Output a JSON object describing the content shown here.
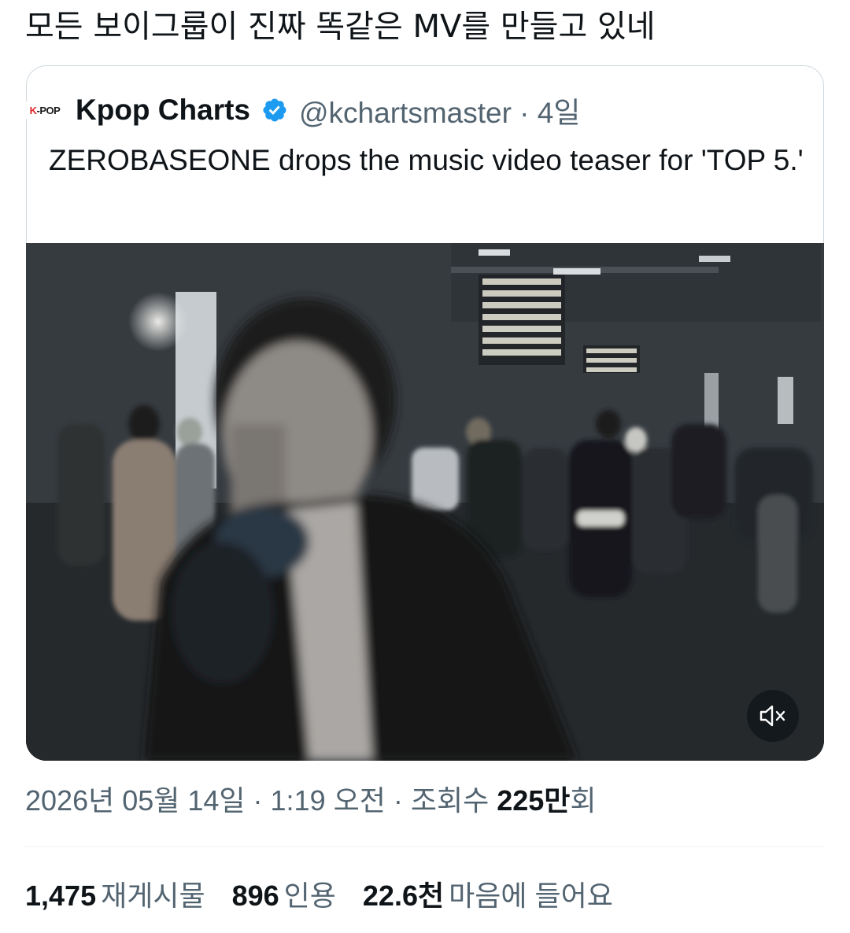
{
  "tweet": {
    "text": "모든 보이그룹이 진짜 똑같은 MV를 만들고 있네"
  },
  "quote": {
    "avatar_text_k": "K",
    "avatar_text_rest": "-POP",
    "display_name": "Kpop Charts",
    "verified_icon": "verified-badge-icon",
    "handle_time": "@kchartsmaster · 4일",
    "text": "ZEROBASEONE drops the music video teaser for 'TOP 5.'",
    "media": {
      "type": "video",
      "mute_icon": "speaker-muted-icon"
    }
  },
  "meta": {
    "date_time": "2026년 05월 14일 · 1:19 오전 · 조회수 ",
    "views_number": "225만",
    "views_suffix": "회"
  },
  "stats": {
    "reposts_count": "1,475",
    "reposts_label": "재게시물",
    "quotes_count": "896",
    "quotes_label": "인용",
    "likes_count": "22.6천",
    "likes_label": "마음에 들어요"
  },
  "colors": {
    "text_primary": "#0f1419",
    "text_secondary": "#536471",
    "border": "#cfd9de",
    "verified": "#1d9bf0"
  }
}
